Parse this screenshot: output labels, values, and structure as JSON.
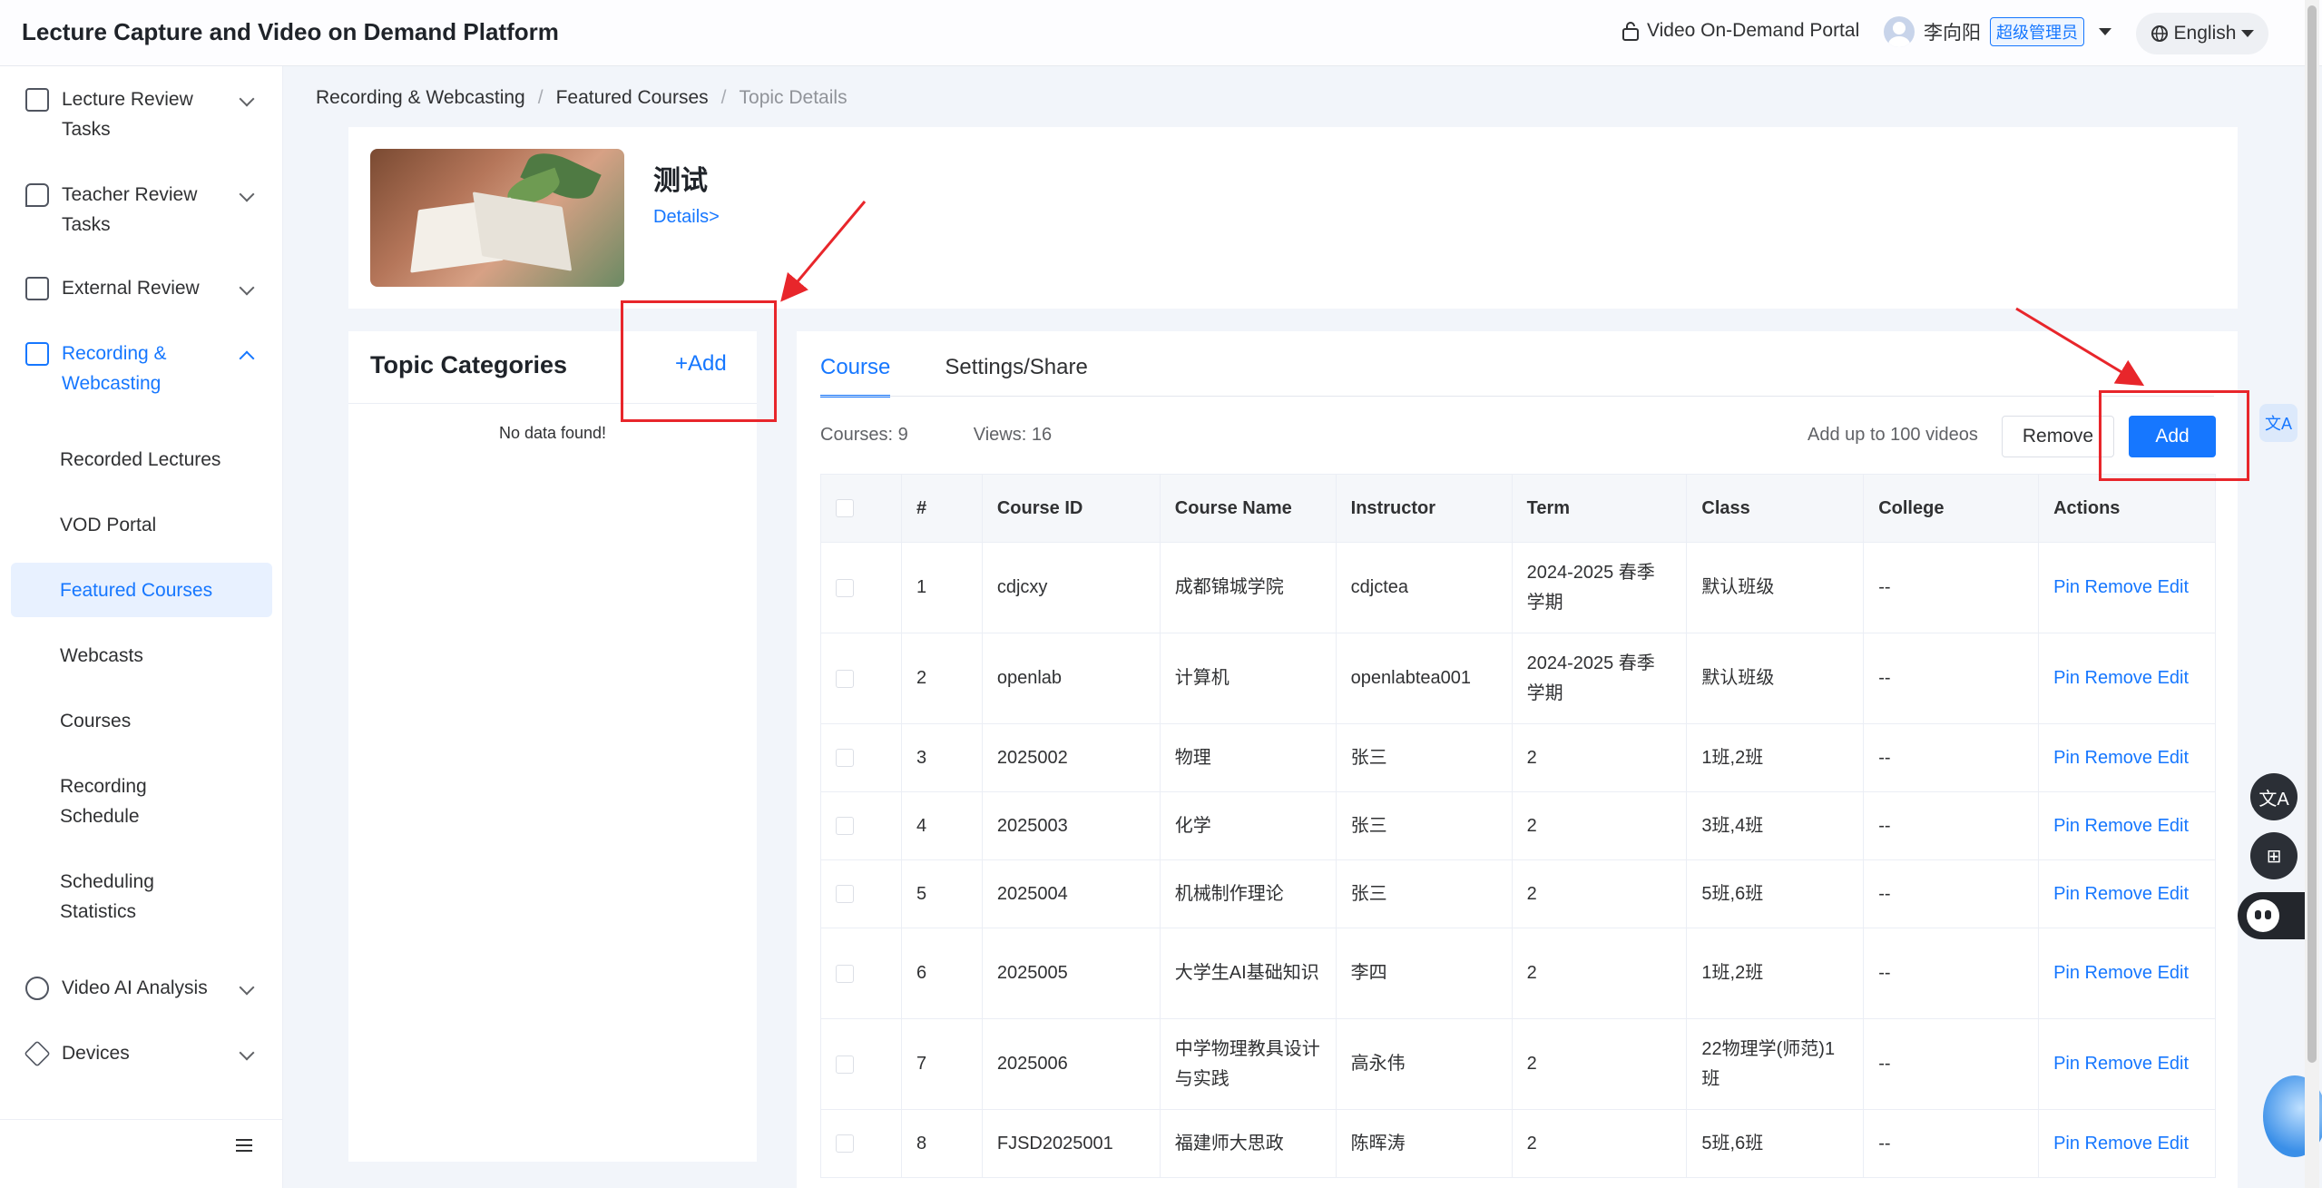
{
  "header": {
    "app_title": "Lecture Capture and Video on Demand Platform",
    "portal_link": "Video On-Demand Portal",
    "user_name": "李向阳",
    "user_role": "超级管理员",
    "language": "English"
  },
  "sidebar": {
    "groups": [
      {
        "label": "Lecture Review Tasks",
        "icon": "review-task-icon"
      },
      {
        "label": "Teacher Review Tasks",
        "icon": "chat-review-icon"
      },
      {
        "label": "External Review",
        "icon": "document-icon"
      },
      {
        "label": "Recording & Webcasting",
        "icon": "camera-icon"
      }
    ],
    "sub_items": [
      "Recorded Lectures",
      "VOD Portal",
      "Featured Courses",
      "Webcasts",
      "Courses",
      "Recording Schedule",
      "Scheduling Statistics"
    ],
    "bottom_groups": [
      {
        "label": "Video AI Analysis",
        "icon": "ai-analysis-icon"
      },
      {
        "label": "Devices",
        "icon": "device-icon"
      }
    ]
  },
  "breadcrumb": [
    "Recording & Webcasting",
    "Featured Courses",
    "Topic Details"
  ],
  "topic": {
    "name": "测试",
    "details_link": "Details>"
  },
  "categories": {
    "title": "Topic Categories",
    "add_label": "+Add",
    "empty_text": "No data found!"
  },
  "course_panel": {
    "tabs": [
      "Course",
      "Settings/Share"
    ],
    "active_tab": "Course",
    "courses_count_text": "Courses: 9",
    "views_text": "Views: 16",
    "limit_text": "Add up to 100 videos",
    "remove_label": "Remove",
    "add_label": "Add",
    "columns": [
      "#",
      "Course ID",
      "Course Name",
      "Instructor",
      "Term",
      "Class",
      "College",
      "Actions"
    ],
    "row_actions": [
      "Pin",
      "Remove",
      "Edit"
    ],
    "rows": [
      {
        "no": "1",
        "course_id": "cdjcxy",
        "course_name": "成都锦城学院",
        "instructor": "cdjctea",
        "term": "2024-2025 春季学期",
        "class": "默认班级",
        "college": "--"
      },
      {
        "no": "2",
        "course_id": "openlab",
        "course_name": "计算机",
        "instructor": "openlabtea001",
        "term": "2024-2025 春季学期",
        "class": "默认班级",
        "college": "--"
      },
      {
        "no": "3",
        "course_id": "2025002",
        "course_name": "物理",
        "instructor": "张三",
        "term": "2",
        "class": "1班,2班",
        "college": "--"
      },
      {
        "no": "4",
        "course_id": "2025003",
        "course_name": "化学",
        "instructor": "张三",
        "term": "2",
        "class": "3班,4班",
        "college": "--"
      },
      {
        "no": "5",
        "course_id": "2025004",
        "course_name": "机械制作理论",
        "instructor": "张三",
        "term": "2",
        "class": "5班,6班",
        "college": "--"
      },
      {
        "no": "6",
        "course_id": "2025005",
        "course_name": "大学生AI基础知识",
        "instructor": "李四",
        "term": "2",
        "class": "1班,2班",
        "college": "--"
      },
      {
        "no": "7",
        "course_id": "2025006",
        "course_name": "中学物理教具设计与实践",
        "instructor": "高永伟",
        "term": "2",
        "class": "22物理学(师范)1班",
        "college": "--"
      },
      {
        "no": "8",
        "course_id": "FJSD2025001",
        "course_name": "福建师大思政",
        "instructor": "陈晖涛",
        "term": "2",
        "class": "5班,6班",
        "college": "--"
      }
    ]
  },
  "floating": {
    "translate_glyph": "文A",
    "language_glyph": "文A",
    "apps_glyph": "⊞"
  },
  "colors": {
    "accent": "#1677ff",
    "annotation": "#e8262b"
  }
}
